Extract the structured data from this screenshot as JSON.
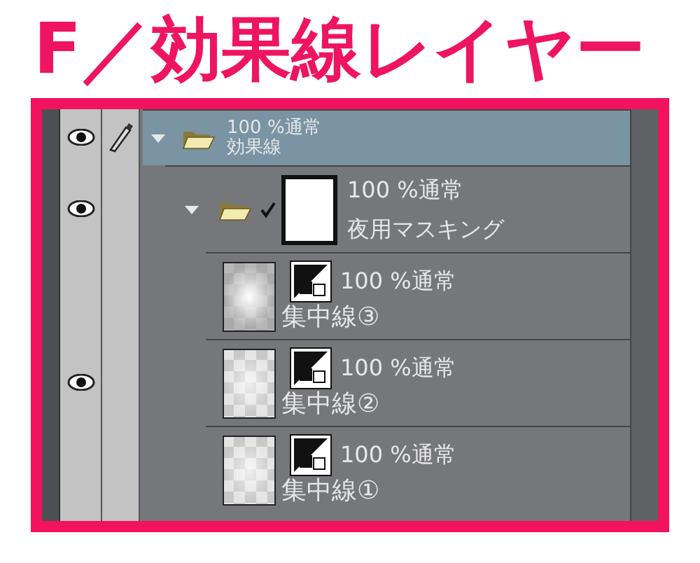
{
  "title": "F／効果線レイヤー",
  "layers": [
    {
      "kind": "folder",
      "mode": "100 %通常",
      "name": "効果線",
      "visible": true,
      "editing": true,
      "selected": true,
      "expanded": true,
      "checked": false,
      "mask": false,
      "children": [
        {
          "kind": "folder",
          "mode": "100 %通常",
          "name": "夜用マスキング",
          "visible": true,
          "editing": false,
          "selected": false,
          "expanded": true,
          "checked": true,
          "mask": true,
          "children": [
            {
              "kind": "raster",
              "mode": "100 %通常",
              "name": "集中線③",
              "visible": false,
              "editing": false,
              "selected": false
            },
            {
              "kind": "raster",
              "mode": "100 %通常",
              "name": "集中線②",
              "visible": true,
              "editing": false,
              "selected": false
            },
            {
              "kind": "raster",
              "mode": "100 %通常",
              "name": "集中線①",
              "visible": false,
              "editing": false,
              "selected": false
            }
          ]
        }
      ]
    }
  ]
}
